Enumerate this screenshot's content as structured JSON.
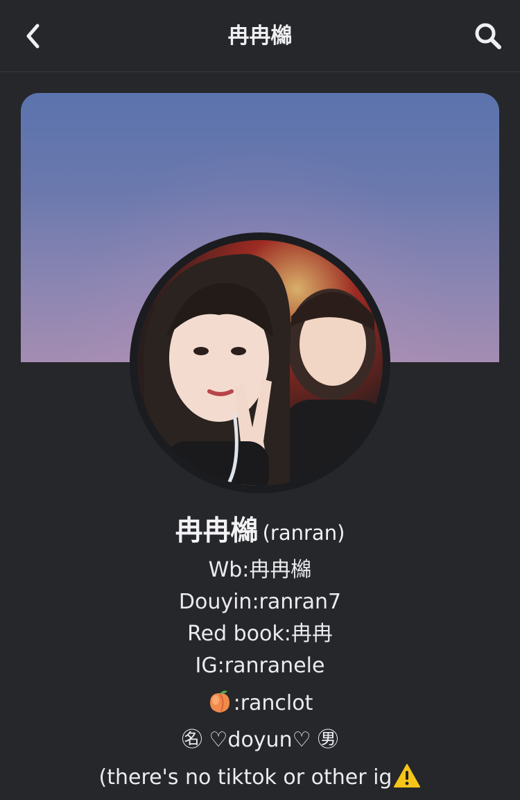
{
  "header": {
    "title": "冉冉檰",
    "back_icon": "chevron-left-icon",
    "search_icon": "search-icon"
  },
  "profile": {
    "display_name": "冉冉檰",
    "alt_name": "(ranran)",
    "bio": [
      "Wb:冉冉檰",
      "Douyin:ranran7",
      "Red book:冉冉",
      "IG:ranranele"
    ],
    "peach_line": ":ranclot",
    "peach_icon": "peach-emoji-icon",
    "hearts_line": "㊔ ♡doyun♡ ㊚",
    "notice_line": "(there's no tiktok or other ig",
    "notice_icon": "warning-emoji-icon"
  },
  "colors": {
    "background": "#26272b",
    "text": "#ececee",
    "banner_top": "#5b73ad",
    "banner_bottom": "#a48db2"
  }
}
